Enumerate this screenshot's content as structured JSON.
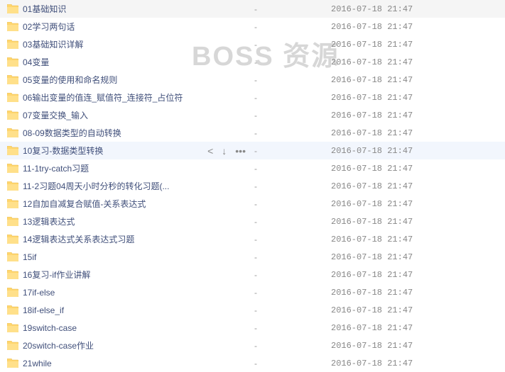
{
  "watermark": "BOSS 资源",
  "size_placeholder": "-",
  "rows": [
    {
      "name": "01基础知识",
      "date": "2016-07-18 21:47",
      "selected": false
    },
    {
      "name": "02学习两句话",
      "date": "2016-07-18 21:47",
      "selected": false
    },
    {
      "name": "03基础知识详解",
      "date": "2016-07-18 21:47",
      "selected": false
    },
    {
      "name": "04变量",
      "date": "2016-07-18 21:47",
      "selected": false
    },
    {
      "name": "05变量的使用和命名规则",
      "date": "2016-07-18 21:47",
      "selected": false
    },
    {
      "name": "06输出变量的值连_赋值符_连接符_占位符",
      "date": "2016-07-18 21:47",
      "selected": false
    },
    {
      "name": "07变量交换_输入",
      "date": "2016-07-18 21:47",
      "selected": false
    },
    {
      "name": "08-09数据类型的自动转换",
      "date": "2016-07-18 21:47",
      "selected": false
    },
    {
      "name": "10复习-数据类型转换",
      "date": "2016-07-18 21:47",
      "selected": true
    },
    {
      "name": "11-1try-catch习题",
      "date": "2016-07-18 21:47",
      "selected": false
    },
    {
      "name": "11-2习题04周天小时分秒的转化习题(...",
      "date": "2016-07-18 21:47",
      "selected": false
    },
    {
      "name": "12自加自减复合赋值-关系表达式",
      "date": "2016-07-18 21:47",
      "selected": false
    },
    {
      "name": "13逻辑表达式",
      "date": "2016-07-18 21:47",
      "selected": false
    },
    {
      "name": "14逻辑表达式关系表达式习题",
      "date": "2016-07-18 21:47",
      "selected": false
    },
    {
      "name": "15if",
      "date": "2016-07-18 21:47",
      "selected": false
    },
    {
      "name": "16复习-if作业讲解",
      "date": "2016-07-18 21:47",
      "selected": false
    },
    {
      "name": "17if-else",
      "date": "2016-07-18 21:47",
      "selected": false
    },
    {
      "name": "18if-else_if",
      "date": "2016-07-18 21:47",
      "selected": false
    },
    {
      "name": "19switch-case",
      "date": "2016-07-18 21:47",
      "selected": false
    },
    {
      "name": "20switch-case作业",
      "date": "2016-07-18 21:47",
      "selected": false
    },
    {
      "name": "21while",
      "date": "2016-07-18 21:47",
      "selected": false
    }
  ]
}
